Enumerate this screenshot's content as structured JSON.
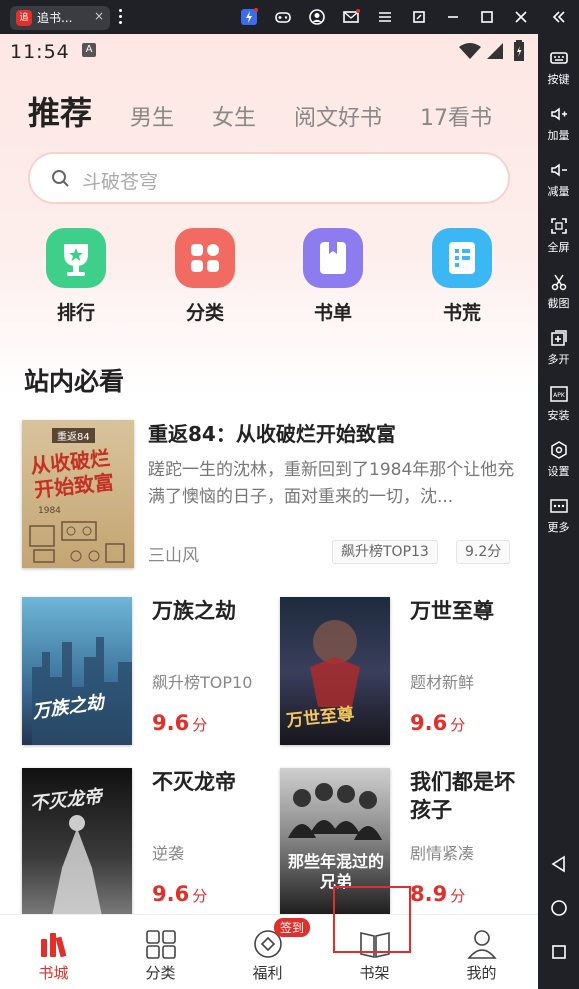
{
  "titlebar": {
    "tab_title": "追书...",
    "tab_logo": "追",
    "close": "×"
  },
  "status": {
    "time": "11:54",
    "badge": "A"
  },
  "tabs": [
    "推荐",
    "男生",
    "女生",
    "阅文好书",
    "17看书"
  ],
  "search": {
    "placeholder": "斗破苍穹"
  },
  "categories": [
    {
      "label": "排行",
      "icon": "trophy-icon",
      "color": "#3ed08a"
    },
    {
      "label": "分类",
      "icon": "grid-icon",
      "color": "#f26b63"
    },
    {
      "label": "书单",
      "icon": "booklist-icon",
      "color": "#8c7cf0"
    },
    {
      "label": "书荒",
      "icon": "list-icon",
      "color": "#3bb8f3"
    }
  ],
  "section": {
    "title": "站内必看"
  },
  "featured": {
    "title": "重返84：从收破烂开始致富",
    "desc": "蹉跎一生的沈林，重新回到了1984年那个让他充满了懊恼的日子，面对重来的一切，沈...",
    "author": "三山风",
    "badge_rank": "飙升榜TOP13",
    "badge_score": "9.2分",
    "cover_lines": [
      "重返84",
      "从收破烂",
      "开始致富",
      "1984"
    ]
  },
  "books": [
    {
      "title": "万族之劫",
      "tag": "飙升榜TOP10",
      "score": "9.6",
      "unit": "分",
      "cover_text": "万族之劫"
    },
    {
      "title": "万世至尊",
      "tag": "题材新鲜",
      "score": "9.6",
      "unit": "分",
      "cover_text": "万世至尊"
    },
    {
      "title": "不灭龙帝",
      "tag": "逆袭",
      "score": "9.6",
      "unit": "分",
      "cover_text": "不灭龙帝"
    },
    {
      "title": "我们都是坏孩子",
      "tag": "剧情紧凑",
      "score": "8.9",
      "unit": "分",
      "cover_text": "那些年混过的兄弟"
    }
  ],
  "nav": {
    "items": [
      "书城",
      "分类",
      "福利",
      "书架",
      "我的"
    ],
    "badge": "签到"
  },
  "sidebar": [
    "按键",
    "加量",
    "减量",
    "全屏",
    "截图",
    "多开",
    "安装",
    "设置",
    "更多"
  ],
  "colors": {
    "accent": "#e0302c"
  }
}
